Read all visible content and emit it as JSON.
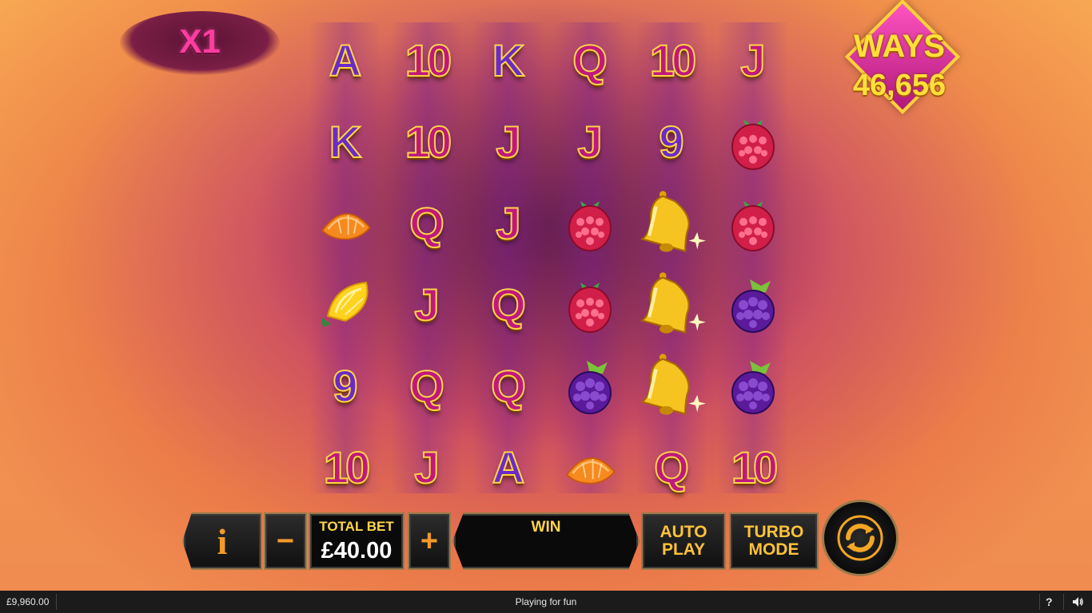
{
  "game": {
    "multiplier": "X1",
    "ways_label": "WAYS",
    "ways_value": "46,656"
  },
  "reels": [
    [
      {
        "symbol": "A",
        "kind": "letter",
        "color": "purple"
      },
      {
        "symbol": "K",
        "kind": "letter",
        "color": "purple"
      },
      {
        "symbol": "orange-slice",
        "kind": "fruit"
      },
      {
        "symbol": "lemon",
        "kind": "fruit"
      },
      {
        "symbol": "9",
        "kind": "letter",
        "color": "purple"
      },
      {
        "symbol": "10",
        "kind": "letter",
        "color": "pink"
      }
    ],
    [
      {
        "symbol": "10",
        "kind": "letter",
        "color": "pink"
      },
      {
        "symbol": "10",
        "kind": "letter",
        "color": "pink"
      },
      {
        "symbol": "Q",
        "kind": "letter",
        "color": "pink"
      },
      {
        "symbol": "J",
        "kind": "letter",
        "color": "pink"
      },
      {
        "symbol": "Q",
        "kind": "letter",
        "color": "pink"
      },
      {
        "symbol": "J",
        "kind": "letter",
        "color": "pink"
      }
    ],
    [
      {
        "symbol": "K",
        "kind": "letter",
        "color": "purple"
      },
      {
        "symbol": "J",
        "kind": "letter",
        "color": "pink"
      },
      {
        "symbol": "J",
        "kind": "letter",
        "color": "pink"
      },
      {
        "symbol": "Q",
        "kind": "letter",
        "color": "pink"
      },
      {
        "symbol": "Q",
        "kind": "letter",
        "color": "pink"
      },
      {
        "symbol": "A",
        "kind": "letter",
        "color": "purple"
      }
    ],
    [
      {
        "symbol": "Q",
        "kind": "letter",
        "color": "pink"
      },
      {
        "symbol": "J",
        "kind": "letter",
        "color": "pink"
      },
      {
        "symbol": "raspberry",
        "kind": "fruit"
      },
      {
        "symbol": "raspberry",
        "kind": "fruit"
      },
      {
        "symbol": "blackberry",
        "kind": "fruit"
      },
      {
        "symbol": "orange-slice",
        "kind": "fruit"
      }
    ],
    [
      {
        "symbol": "10",
        "kind": "letter",
        "color": "pink"
      },
      {
        "symbol": "9",
        "kind": "letter",
        "color": "purple"
      },
      {
        "symbol": "bell",
        "kind": "fruit"
      },
      {
        "symbol": "bell",
        "kind": "fruit"
      },
      {
        "symbol": "bell",
        "kind": "fruit"
      },
      {
        "symbol": "Q",
        "kind": "letter",
        "color": "pink"
      }
    ],
    [
      {
        "symbol": "J",
        "kind": "letter",
        "color": "pink"
      },
      {
        "symbol": "raspberry",
        "kind": "fruit"
      },
      {
        "symbol": "raspberry",
        "kind": "fruit"
      },
      {
        "symbol": "blackberry",
        "kind": "fruit"
      },
      {
        "symbol": "blackberry",
        "kind": "fruit"
      },
      {
        "symbol": "10",
        "kind": "letter",
        "color": "pink"
      }
    ]
  ],
  "controls": {
    "info_label": "i",
    "minus_label": "−",
    "total_bet_label": "TOTAL BET",
    "total_bet_value": "£40.00",
    "plus_label": "+",
    "win_label": "WIN",
    "win_value": "",
    "auto_play_line1": "AUTO",
    "auto_play_line2": "PLAY",
    "turbo_line1": "TURBO",
    "turbo_line2": "MODE",
    "spin_icon": "spin-arrows-icon"
  },
  "footer": {
    "balance": "£9,960.00",
    "status": "Playing for fun",
    "help_label": "?",
    "sound_icon": "speaker-icon"
  },
  "colors": {
    "accent_gold": "#ffd54a",
    "accent_orange": "#f39a2a",
    "letter_pink": "#c0187c",
    "letter_purple": "#6b2bc7",
    "multiplier_pink": "#ff3da0"
  }
}
